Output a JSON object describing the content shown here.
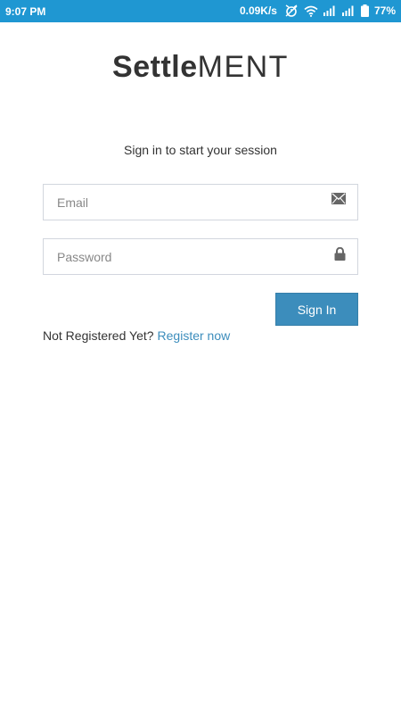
{
  "status_bar": {
    "time": "9:07 PM",
    "network_speed": "0.09K/s",
    "battery": "77%",
    "icons": [
      "alarm-off-icon",
      "wifi-icon",
      "signal-icon",
      "signal-icon",
      "battery-icon"
    ],
    "color": "#1f97d2"
  },
  "logo": {
    "bold_part": "Settle",
    "light_part": "MENT"
  },
  "login": {
    "subtitle": "Sign in to start your session",
    "email_placeholder": "Email",
    "email_icon": "envelope-icon",
    "password_placeholder": "Password",
    "password_icon": "lock-icon",
    "signin_label": "Sign In",
    "signin_color": "#3c8dbc"
  },
  "register": {
    "prompt": "Not Registered Yet?",
    "link_label": "Register now"
  }
}
